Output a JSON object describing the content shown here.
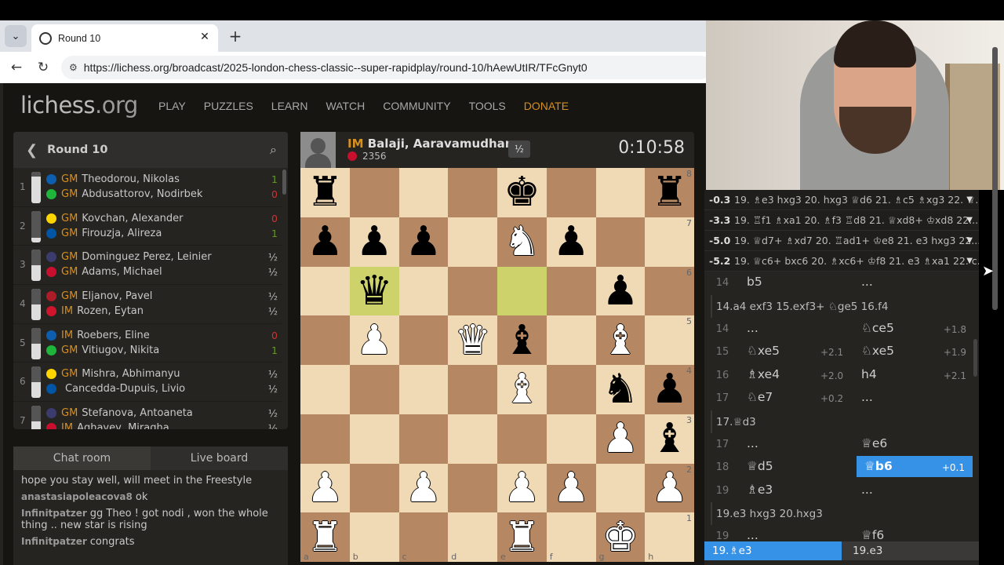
{
  "browser": {
    "tab_title": "Round 10",
    "url": "https://lichess.org/broadcast/2025-london-chess-classic--super-rapidplay/round-10/hAewUtIR/TFcGnyt0"
  },
  "site": {
    "logo": "lichess",
    "logo_tld": ".org",
    "nav": [
      "PLAY",
      "PUZZLES",
      "LEARN",
      "WATCH",
      "COMMUNITY",
      "TOOLS",
      "DONATE"
    ]
  },
  "round": {
    "title": "Round 10",
    "games": [
      {
        "num": "1",
        "white": {
          "title": "GM",
          "name": "Theodorou, Nikolas",
          "res": "1"
        },
        "black": {
          "title": "GM",
          "name": "Abdusattorov, Nodirbek",
          "res": "0"
        },
        "bar": 0.15
      },
      {
        "num": "2",
        "white": {
          "title": "GM",
          "name": "Kovchan, Alexander",
          "res": "0"
        },
        "black": {
          "title": "GM",
          "name": "Firouzja, Alireza",
          "res": "1"
        },
        "bar": 0.85
      },
      {
        "num": "3",
        "white": {
          "title": "GM",
          "name": "Dominguez Perez, Leinier",
          "res": "½"
        },
        "black": {
          "title": "GM",
          "name": "Adams, Michael",
          "res": "½"
        },
        "bar": 0.5
      },
      {
        "num": "4",
        "white": {
          "title": "GM",
          "name": "Eljanov, Pavel",
          "res": "½"
        },
        "black": {
          "title": "IM",
          "name": "Rozen, Eytan",
          "res": "½"
        },
        "bar": 0.5
      },
      {
        "num": "5",
        "white": {
          "title": "IM",
          "name": "Roebers, Eline",
          "res": "0"
        },
        "black": {
          "title": "GM",
          "name": "Vitiugov, Nikita",
          "res": "1"
        },
        "bar": 0.5
      },
      {
        "num": "6",
        "white": {
          "title": "GM",
          "name": "Mishra, Abhimanyu",
          "res": "½"
        },
        "black": {
          "title": "",
          "name": "Cancedda-Dupuis, Livio",
          "res": "½"
        },
        "bar": 0.5
      },
      {
        "num": "7",
        "white": {
          "title": "GM",
          "name": "Stefanova, Antoaneta",
          "res": "½"
        },
        "black": {
          "title": "IM",
          "name": "Aghayev, Miragha",
          "res": "½"
        },
        "bar": 0.5
      }
    ]
  },
  "chat": {
    "tabs": [
      "Chat room",
      "Live board"
    ],
    "lines": [
      {
        "user": "",
        "text": "hope you stay well, will meet in the Freestyle"
      },
      {
        "user": "anastasiapoleacova8",
        "text": "ok"
      },
      {
        "user": "Infinitpatzer",
        "text": "gg Theo ! got nodi , won the whole thing .. new star is rising"
      },
      {
        "user": "Infinitpatzer",
        "text": "congrats"
      }
    ]
  },
  "player_top": {
    "title": "IM",
    "name": "Balaji, Aaravamudhan",
    "rating": "2356",
    "badge": "½",
    "clock": "0:10:58"
  },
  "board": {
    "ranks": [
      "8",
      "7",
      "6",
      "5",
      "4",
      "3",
      "2",
      "1"
    ],
    "files": [
      "a",
      "b",
      "c",
      "d",
      "e",
      "f",
      "g",
      "h"
    ],
    "position": [
      [
        "bR",
        "",
        "",
        "",
        "bK",
        "",
        "",
        "bR"
      ],
      [
        "bP",
        "bP",
        "bP",
        "",
        "wN",
        "bP",
        "",
        ""
      ],
      [
        "",
        "bQ",
        "",
        "",
        "",
        "",
        "bP",
        ""
      ],
      [
        "",
        "wP",
        "",
        "wQ",
        "bB",
        "",
        "wB",
        ""
      ],
      [
        "",
        "",
        "",
        "",
        "wB",
        "",
        "bN",
        "bP"
      ],
      [
        "",
        "",
        "",
        "",
        "",
        "",
        "wP",
        "bB"
      ],
      [
        "wP",
        "",
        "wP",
        "",
        "wP",
        "wP",
        "",
        "wP"
      ],
      [
        "wR",
        "",
        "",
        "",
        "wR",
        "",
        "wK",
        ""
      ]
    ],
    "highlight": [
      "b6",
      "e6"
    ]
  },
  "analysis": {
    "pv_lines": [
      {
        "eval": "-0.3",
        "text": "19. ♗e3 hxg3 20. hxg3 ♕d6 21. ♗c5 ♗xg3 22. ♕..."
      },
      {
        "eval": "-3.3",
        "text": "19. ♖f1 ♗xa1 20. ♗f3 ♖d8 21. ♕xd8+ ♔xd8 22...."
      },
      {
        "eval": "-5.0",
        "text": "19. ♕d7+ ♗xd7 20. ♖ad1+ ♔e8 21. e3 hxg3 22...."
      },
      {
        "eval": "-5.2",
        "text": "19. ♕c6+ bxc6 20. ♗xc6+ ♔f8 21. e3 ♗xa1 22. c..."
      }
    ],
    "moves": [
      {
        "type": "row",
        "n": "14",
        "m1": "b5",
        "e1": "",
        "m2": "...",
        "e2": ""
      },
      {
        "type": "inter",
        "text": "14.a4 exf3 15.exf3+ ♘ge5 16.f4"
      },
      {
        "type": "row",
        "n": "14",
        "m1": "...",
        "e1": "",
        "m2": "♘ce5",
        "e2": "+1.8"
      },
      {
        "type": "row",
        "n": "15",
        "m1": "♘xe5",
        "e1": "+2.1",
        "m2": "♘xe5",
        "e2": "+1.9"
      },
      {
        "type": "row",
        "n": "16",
        "m1": "♗xe4",
        "e1": "+2.0",
        "m2": "h4",
        "e2": "+2.1"
      },
      {
        "type": "row",
        "n": "17",
        "m1": "♘e7",
        "e1": "+0.2",
        "m2": "...",
        "e2": ""
      },
      {
        "type": "inter",
        "text": "17.♕d3"
      },
      {
        "type": "row",
        "n": "17",
        "m1": "...",
        "e1": "",
        "m2": "♕e6",
        "e2": ""
      },
      {
        "type": "row",
        "n": "18",
        "m1": "♕d5",
        "e1": "",
        "m2": "♕b6",
        "e2": "+0.1",
        "selected": true
      },
      {
        "type": "row",
        "n": "19",
        "m1": "♗e3",
        "e1": "",
        "m2": "...",
        "e2": ""
      },
      {
        "type": "inter",
        "text": "19.e3 hxg3 20.hxg3"
      },
      {
        "type": "row",
        "n": "19",
        "m1": "...",
        "e1": "",
        "m2": "♕f6",
        "e2": ""
      }
    ],
    "bottom": [
      "19.♗e3",
      "19.e3"
    ]
  }
}
